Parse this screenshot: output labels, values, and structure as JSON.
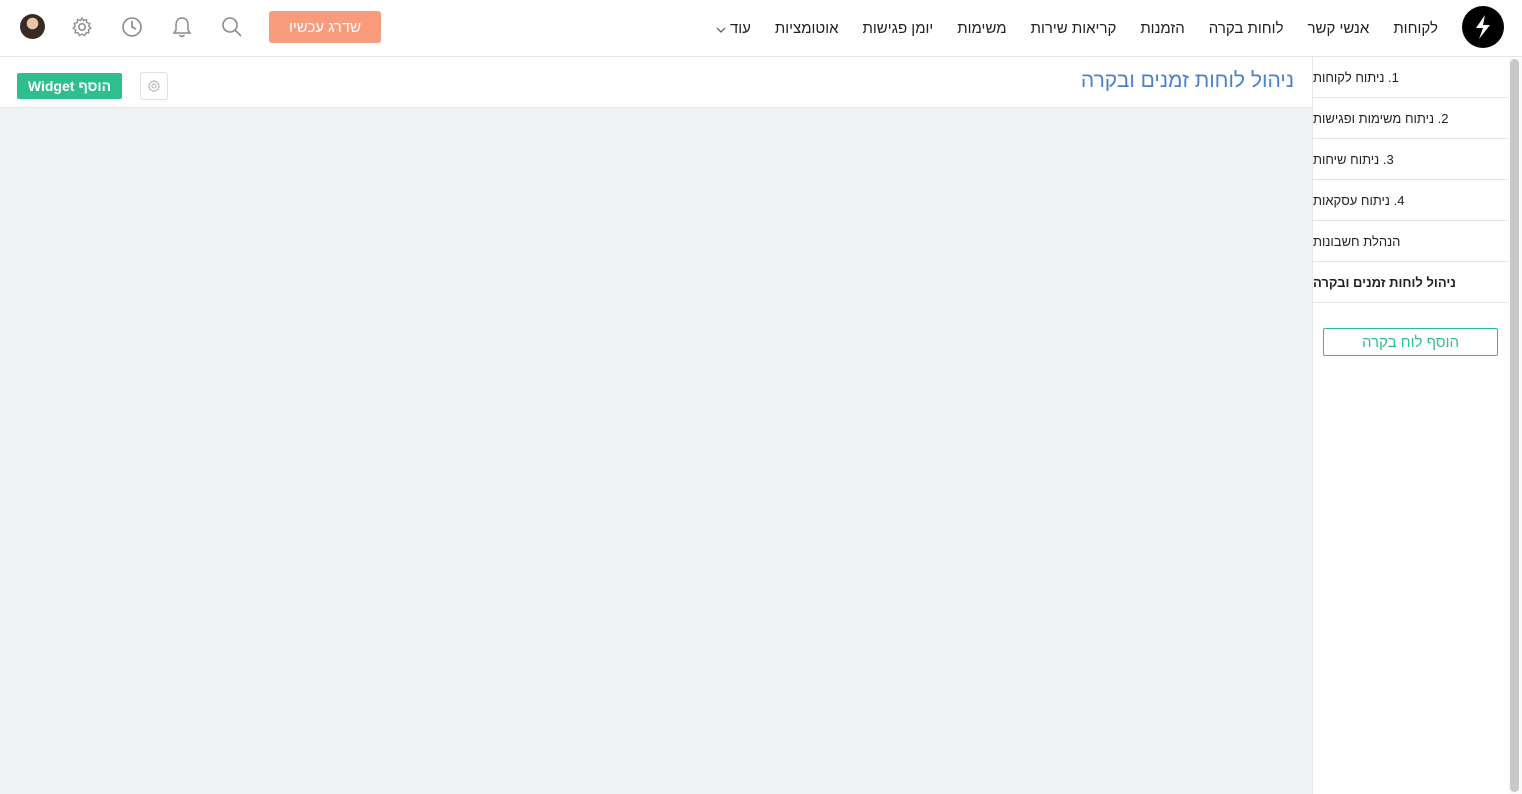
{
  "nav": {
    "items": [
      {
        "label": "לקוחות"
      },
      {
        "label": "אנשי קשר"
      },
      {
        "label": "לוחות בקרה"
      },
      {
        "label": "הזמנות"
      },
      {
        "label": "קריאות שירות"
      },
      {
        "label": "משימות"
      },
      {
        "label": "יומן פגישות"
      },
      {
        "label": "אוטומציות"
      }
    ],
    "more_label": "עוד",
    "upgrade_label": "שדרג עכשיו",
    "icons": [
      "search-icon",
      "bell-icon",
      "clock-icon",
      "gear-icon"
    ]
  },
  "sidebar": {
    "items": [
      {
        "label": "1. ניתוח לקוחות"
      },
      {
        "label": "2. ניתוח משימות ופגישות"
      },
      {
        "label": "3. ניתוח שיחות"
      },
      {
        "label": "4. ניתוח עסקאות"
      },
      {
        "label": "הנהלת חשבונות"
      },
      {
        "label": "ניהול לוחות זמנים ובקרה"
      }
    ],
    "active_index": 5,
    "add_board_label": "הוסף לוח בקרה"
  },
  "main": {
    "title": "ניהול לוחות זמנים ובקרה",
    "add_widget_label": "הוסף Widget"
  },
  "colors": {
    "accent_green": "#2fbf8c",
    "upgrade_orange": "#f99b7d",
    "title_blue": "#4a7fcf",
    "content_bg": "#f1f2f4"
  }
}
